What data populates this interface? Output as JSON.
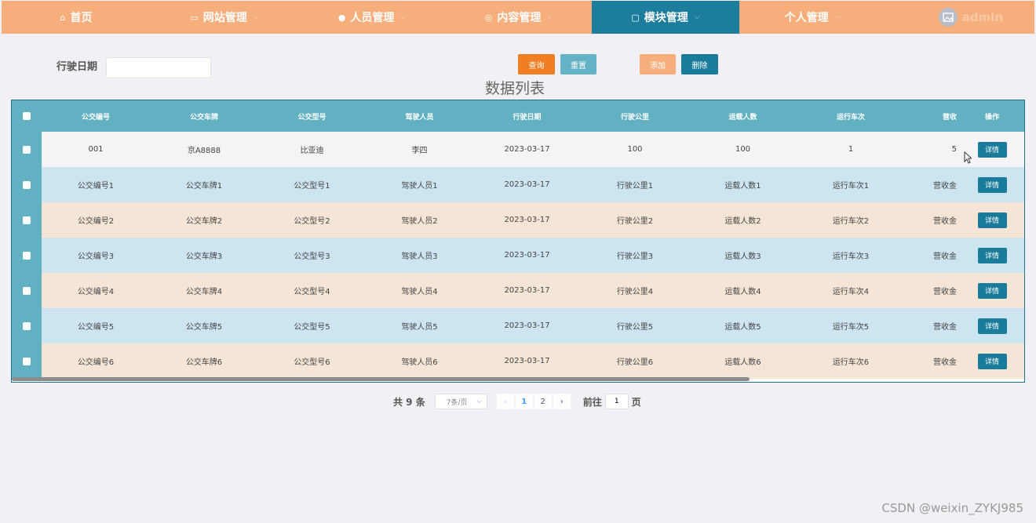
{
  "nav": {
    "items": [
      {
        "label": "首页",
        "icon": "⌂",
        "chevron": false
      },
      {
        "label": "网站管理",
        "icon": "▭",
        "chevron": true
      },
      {
        "label": "人员管理",
        "icon": "●",
        "chevron": true
      },
      {
        "label": "内容管理",
        "icon": "◎",
        "chevron": true
      },
      {
        "label": "模块管理",
        "icon": "▢",
        "chevron": true
      },
      {
        "label": "个人管理",
        "icon": "",
        "chevron": true
      }
    ],
    "user": "admin",
    "active_color": "#1c7e9c",
    "bar_color": "#f5ae7c"
  },
  "search": {
    "label": "行驶日期",
    "value": ""
  },
  "buttons": {
    "query": "查询",
    "reset": "重置",
    "add": "添加",
    "delete": "删除"
  },
  "list_title": "数据列表",
  "table": {
    "headers": [
      "公交编号",
      "公交车牌",
      "公交型号",
      "驾驶人员",
      "行驶日期",
      "行驶公里",
      "运载人数",
      "运行车次",
      "营收",
      "操作"
    ],
    "rows": [
      [
        "001",
        "京A8888",
        "比亚迪",
        "李四",
        "2023-03-17",
        "100",
        "100",
        "1",
        "5"
      ],
      [
        "公交编号1",
        "公交车牌1",
        "公交型号1",
        "驾驶人员1",
        "2023-03-17",
        "行驶公里1",
        "运载人数1",
        "运行车次1",
        "营收金"
      ],
      [
        "公交编号2",
        "公交车牌2",
        "公交型号2",
        "驾驶人员2",
        "2023-03-17",
        "行驶公里2",
        "运载人数2",
        "运行车次2",
        "营收金"
      ],
      [
        "公交编号3",
        "公交车牌3",
        "公交型号3",
        "驾驶人员3",
        "2023-03-17",
        "行驶公里3",
        "运载人数3",
        "运行车次3",
        "营收金"
      ],
      [
        "公交编号4",
        "公交车牌4",
        "公交型号4",
        "驾驶人员4",
        "2023-03-17",
        "行驶公里4",
        "运载人数4",
        "运行车次4",
        "营收金"
      ],
      [
        "公交编号5",
        "公交车牌5",
        "公交型号5",
        "驾驶人员5",
        "2023-03-17",
        "行驶公里5",
        "运载人数5",
        "运行车次5",
        "营收金"
      ],
      [
        "公交编号6",
        "公交车牌6",
        "公交型号6",
        "驾驶人员6",
        "2023-03-17",
        "行驶公里6",
        "运载人数6",
        "运行车次6",
        "营收金"
      ]
    ],
    "detail_label": "详情"
  },
  "pager": {
    "total": "共 9 条",
    "page_size": "7条/页",
    "prev": "‹",
    "pages": [
      "1",
      "2"
    ],
    "next": "›",
    "goto_prefix": "前往",
    "goto_value": "1",
    "goto_suffix": "页"
  },
  "watermark": "CSDN @weixin_ZYKJ985"
}
